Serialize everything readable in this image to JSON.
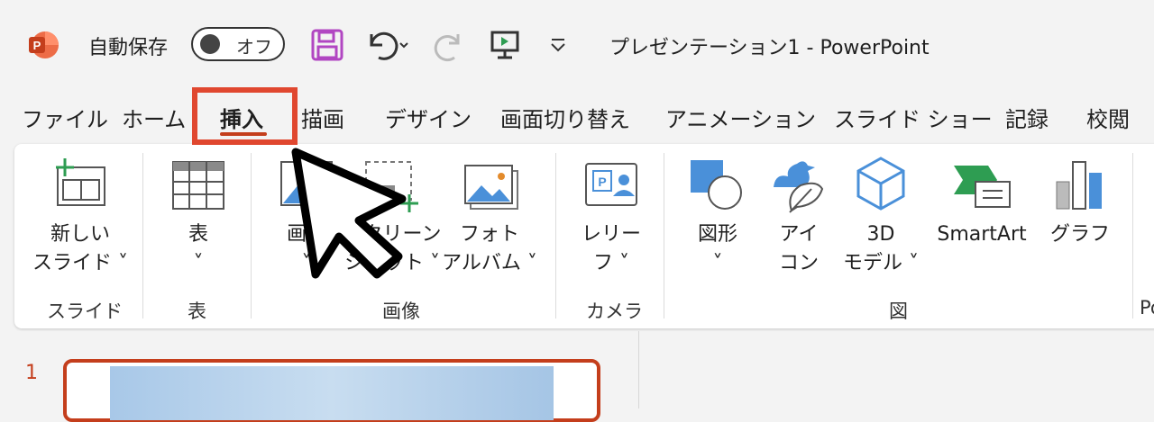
{
  "titlebar": {
    "autosave_label": "自動保存",
    "autosave_state": "オフ",
    "document_title": "プレゼンテーション1  -  PowerPoint",
    "accent_color": "#c43e1c"
  },
  "tabs": [
    {
      "label": "ファイル"
    },
    {
      "label": "ホーム"
    },
    {
      "label": "挿入",
      "active": true
    },
    {
      "label": "描画"
    },
    {
      "label": "デザイン"
    },
    {
      "label": "画面切り替え"
    },
    {
      "label": "アニメーション"
    },
    {
      "label": "スライド ショー"
    },
    {
      "label": "記録"
    },
    {
      "label": "校閲"
    }
  ],
  "ribbon": {
    "slides": {
      "new_slide_line1": "新しい",
      "new_slide_line2": "スライド ˅",
      "group": "スライド"
    },
    "table": {
      "label": "表",
      "chev": "˅",
      "group": "表"
    },
    "images": {
      "image_line1": "画像",
      "image_chev": "˅",
      "screenshot_line1": "スクリーン",
      "screenshot_line2": "ショット ˅",
      "album_line1": "フォト",
      "album_line2": "アルバム ˅",
      "group": "画像"
    },
    "camera": {
      "cameo_line1": "レリー",
      "cameo_line2": "フ ˅",
      "group": "カメラ"
    },
    "illustrations": {
      "shapes": "図形",
      "shapes_chev": "˅",
      "icons_line1": "アイ",
      "icons_line2": "コン",
      "models_line1": "3D",
      "models_line2": "モデル ˅",
      "smartart": "SmartArt",
      "chart": "グラフ",
      "group": "図"
    },
    "partial_group": "Po"
  },
  "slide_panel": {
    "slide_number": "1"
  }
}
